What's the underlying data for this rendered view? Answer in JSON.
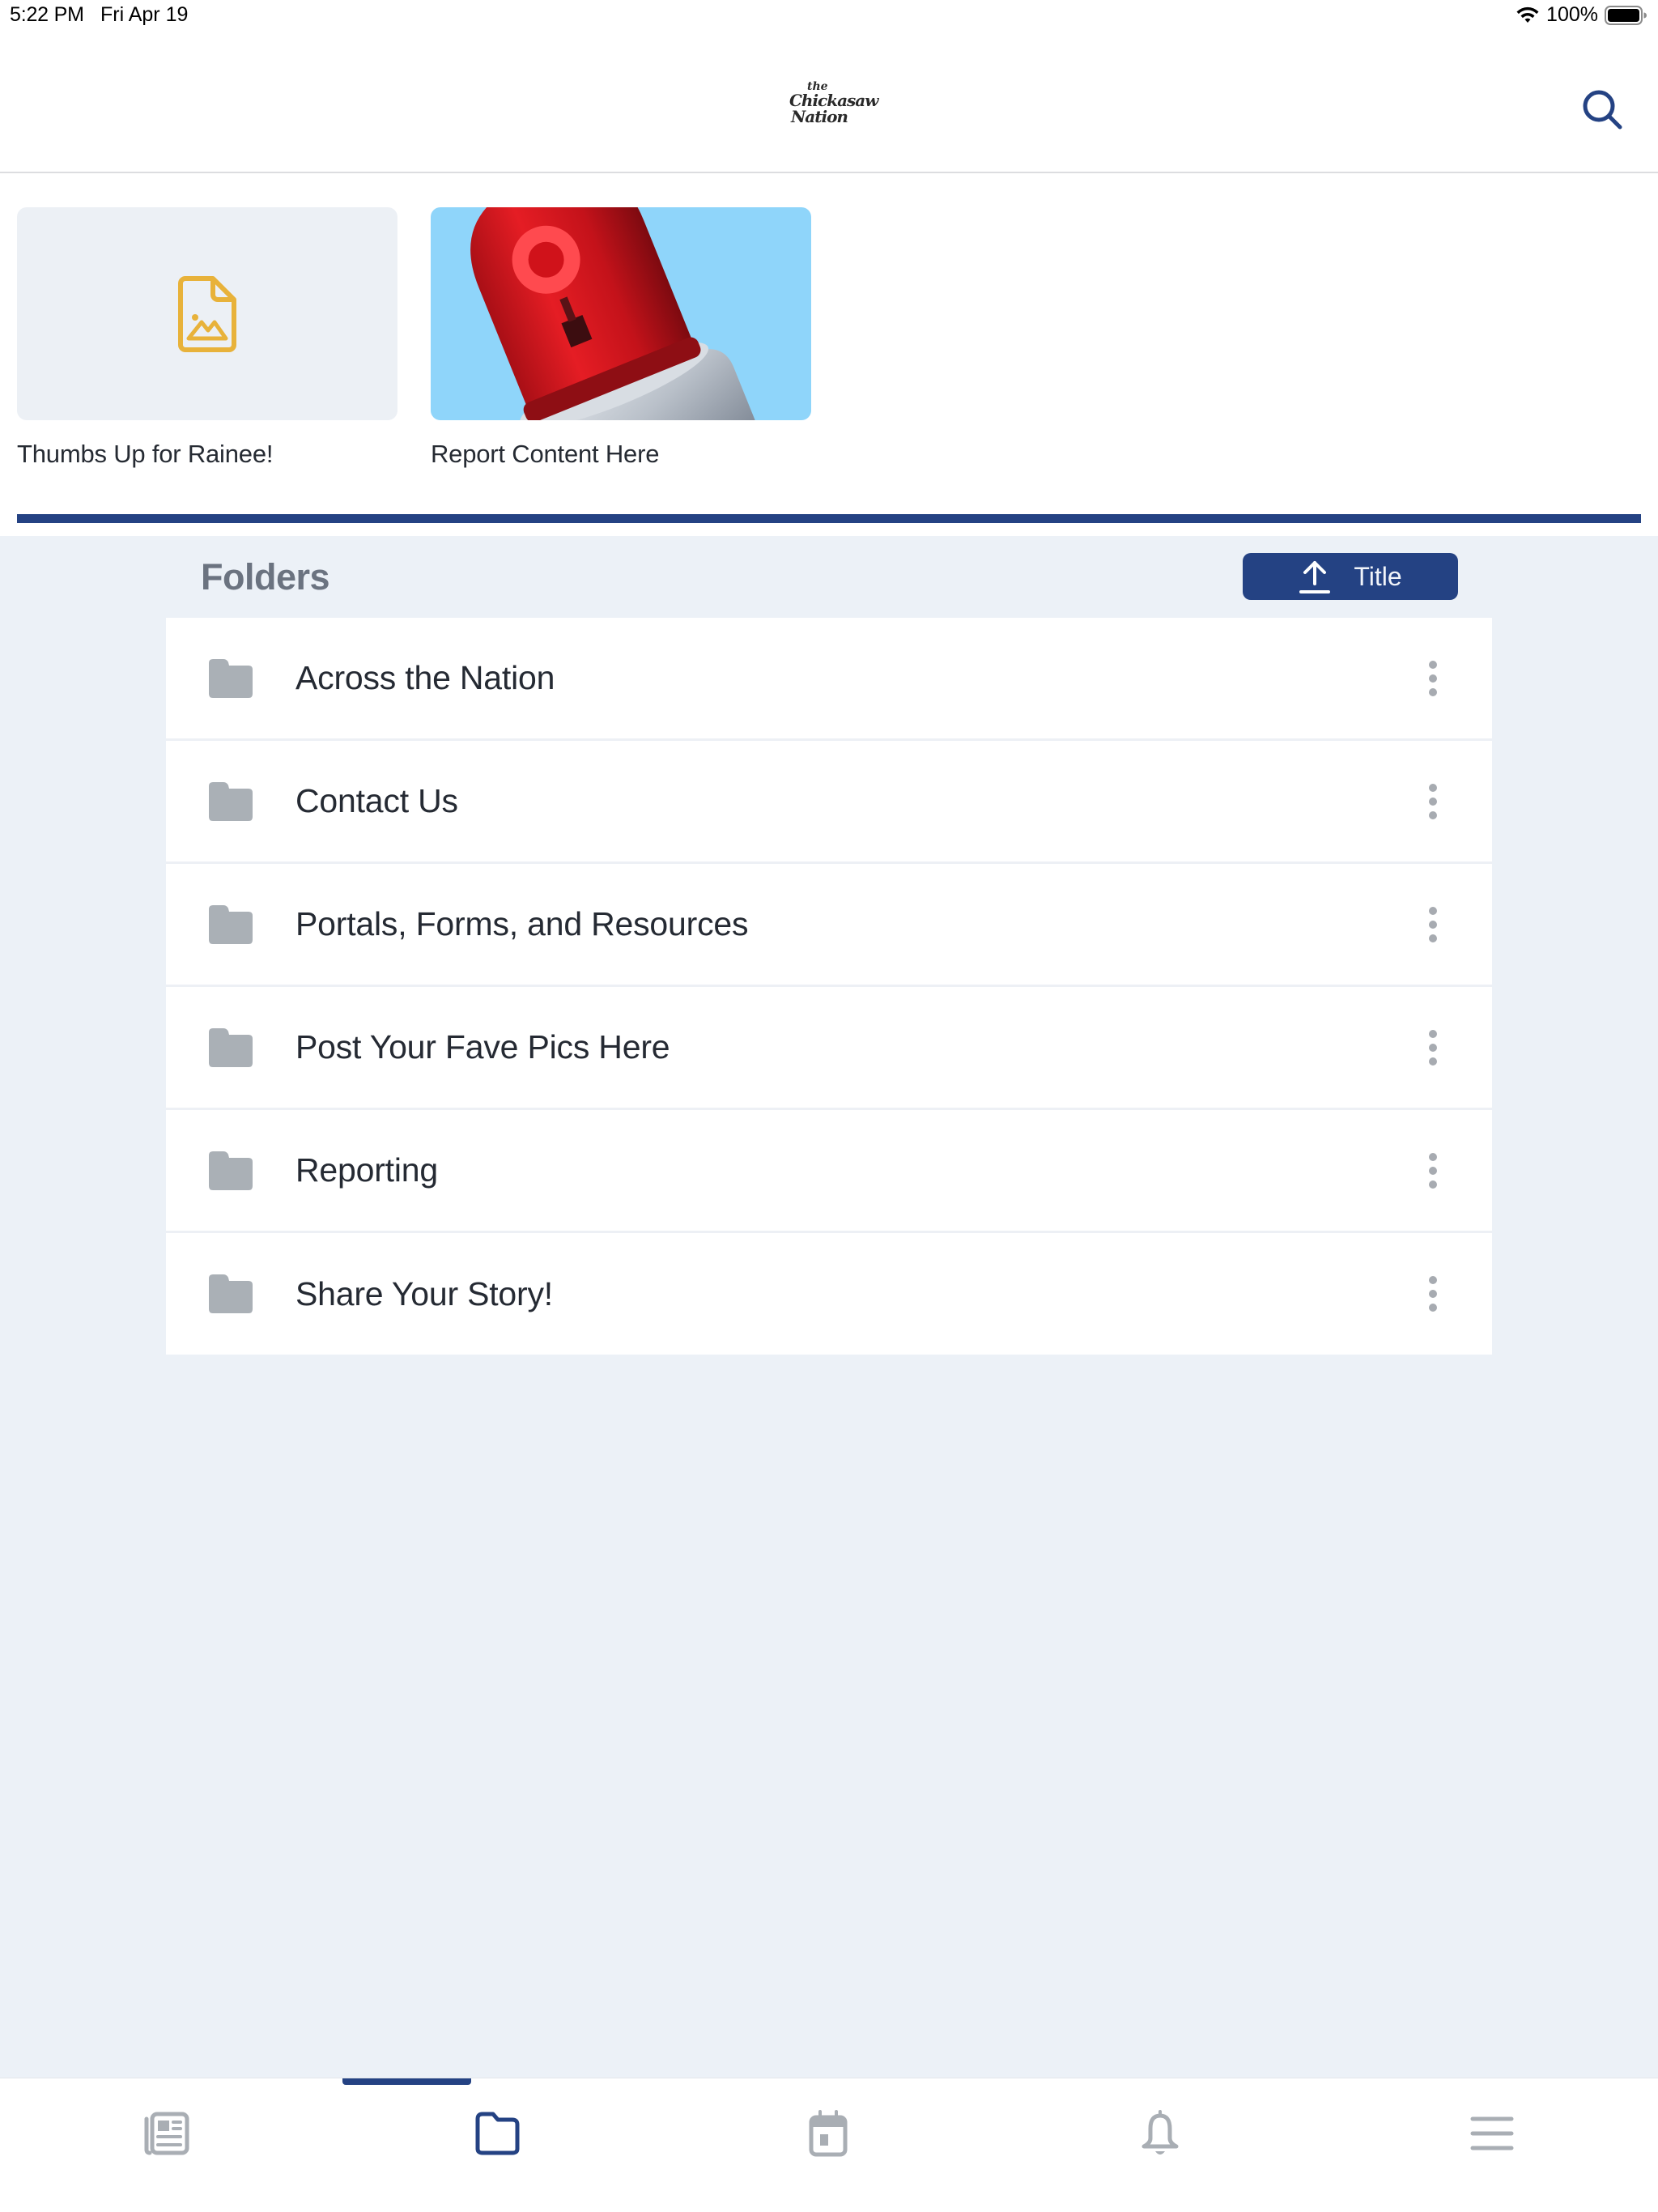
{
  "status_bar": {
    "time": "5:22 PM",
    "date": "Fri Apr 19",
    "wifi_icon": "wifi-icon",
    "battery_percent": "100%",
    "battery_icon": "battery-full-icon"
  },
  "header": {
    "logo": {
      "line_the": "the",
      "line_1": "Chickasaw",
      "line_2": "Nation"
    },
    "search_icon": "search-icon"
  },
  "featured": [
    {
      "title": "Thumbs Up for Rainee!",
      "thumbnail": "image-file-placeholder-icon",
      "icon_color": "#e8b23a"
    },
    {
      "title": "Report Content Here",
      "thumbnail": "red-siren-light-image"
    }
  ],
  "folders": {
    "title": "Folders",
    "sort": {
      "label": "Title",
      "icon": "sort-upload-arrow-icon"
    },
    "items": [
      {
        "name": "Across the Nation"
      },
      {
        "name": "Contact Us"
      },
      {
        "name": "Portals, Forms, and Resources"
      },
      {
        "name": "Post Your Fave Pics Here"
      },
      {
        "name": "Reporting"
      },
      {
        "name": "Share Your Story!"
      }
    ]
  },
  "tabs": [
    {
      "name": "news",
      "icon": "newspaper-icon",
      "active": false
    },
    {
      "name": "folders",
      "icon": "folder-icon",
      "active": true
    },
    {
      "name": "calendar",
      "icon": "calendar-icon",
      "active": false
    },
    {
      "name": "notifications",
      "icon": "bell-icon",
      "active": false
    },
    {
      "name": "menu",
      "icon": "hamburger-menu-icon",
      "active": false
    }
  ],
  "colors": {
    "brand": "#244283",
    "inactive_icon": "#a9aeb4",
    "folder_icon": "#aab0b6",
    "section_bg": "#ecf1f7",
    "title_gray": "#6b7380"
  }
}
